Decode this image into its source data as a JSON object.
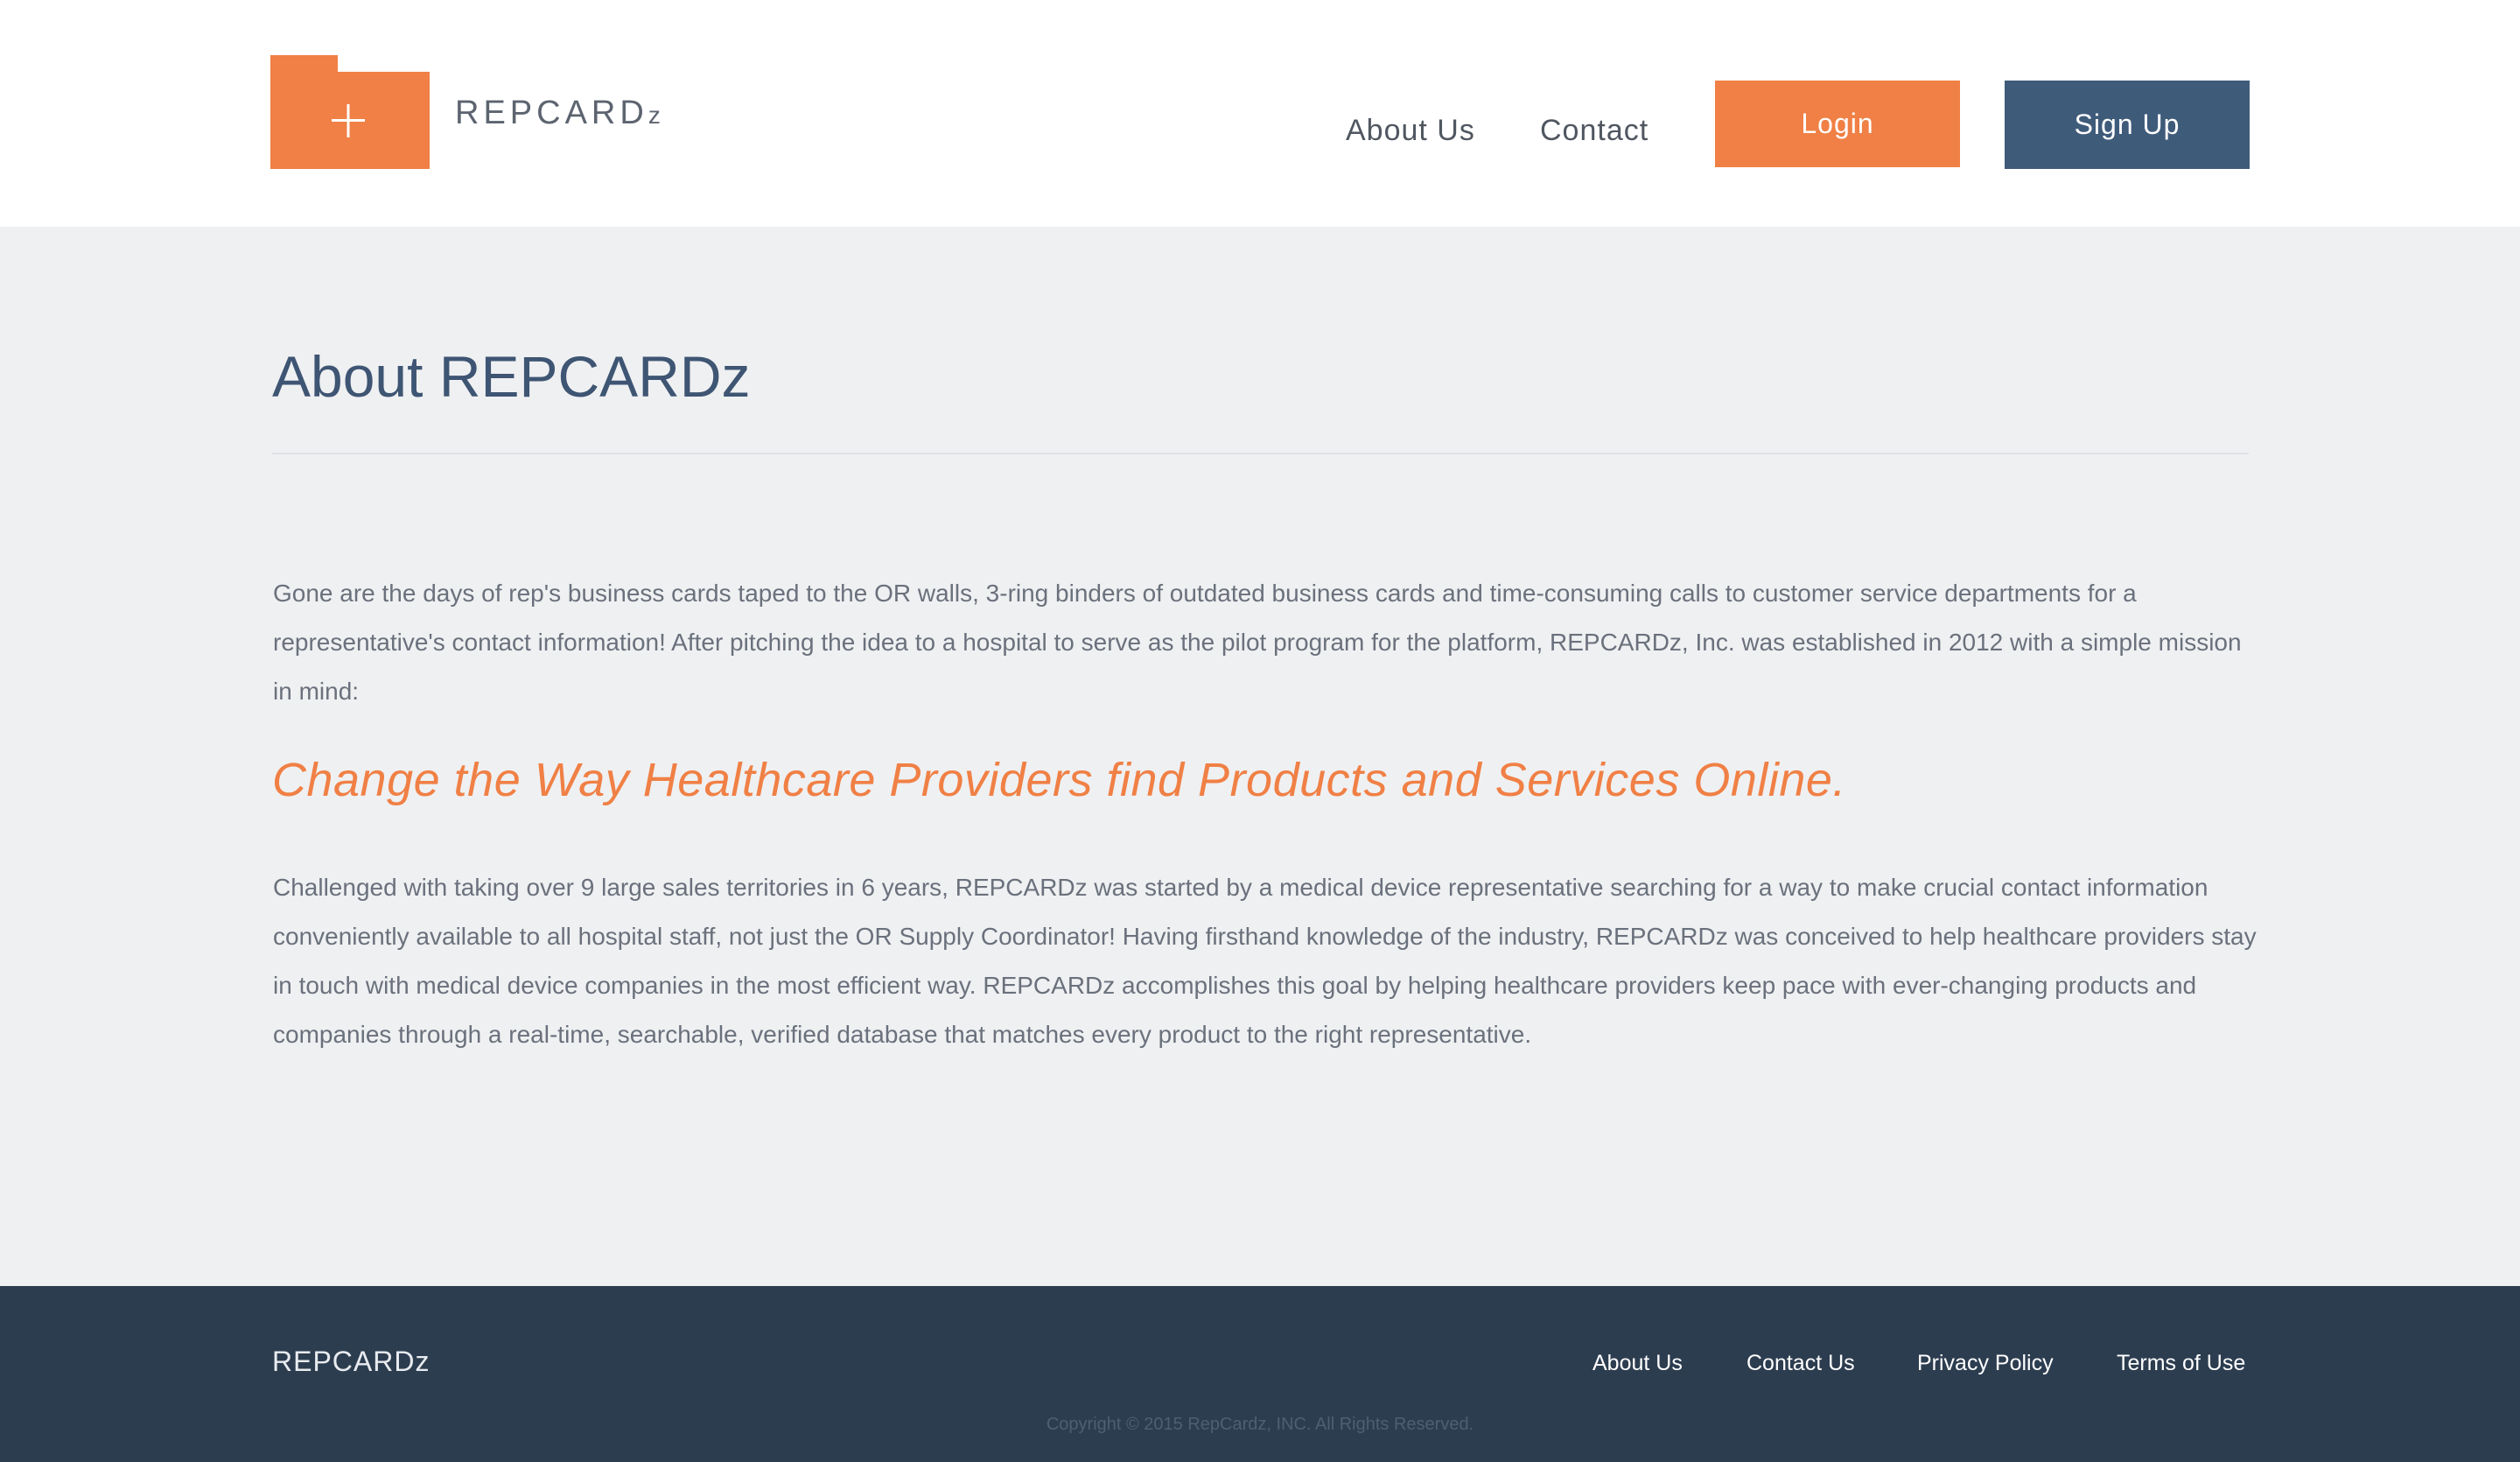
{
  "header": {
    "logo_text": "REPCARD",
    "logo_text_suffix": "z",
    "nav": {
      "about": "About Us",
      "contact": "Contact"
    },
    "login_label": "Login",
    "signup_label": "Sign Up"
  },
  "main": {
    "title": "About REPCARDz",
    "paragraph_1": "Gone are the days of rep's business cards taped to the OR walls, 3-ring binders of outdated business cards and time-consuming calls to customer service departments for a representative's contact information!  After pitching the idea to a hospital to serve as the pilot program for the platform, REPCARDz, Inc. was established in 2012 with a simple mission in mind:",
    "mission": "Change the Way Healthcare Providers find Products and Services Online.",
    "paragraph_2": "Challenged with taking over 9 large sales territories in 6 years, REPCARDz was started by a medical device representative searching for a way to make crucial contact information conveniently available to all hospital staff, not just the OR Supply Coordinator!  Having firsthand knowledge of the industry, REPCARDz was conceived to help healthcare providers stay in touch with medical device companies in the most efficient way. REPCARDz accomplishes this goal by helping healthcare providers keep pace with ever-changing products and companies through a real-time, searchable, verified database that matches every product to the right representative."
  },
  "footer": {
    "brand": "REPCARDz",
    "links": {
      "about": "About Us",
      "contact": "Contact Us",
      "privacy": "Privacy Policy",
      "terms": "Terms of Use"
    },
    "copyright": "Copyright © 2015 RepCardz, INC. All Rights Reserved."
  },
  "colors": {
    "accent_orange": "#f08045",
    "navy_button": "#3f5b7a",
    "footer_background": "#2d3d50",
    "page_background": "#eff0f2"
  },
  "icons": {
    "logo": "folder-plus-icon"
  }
}
